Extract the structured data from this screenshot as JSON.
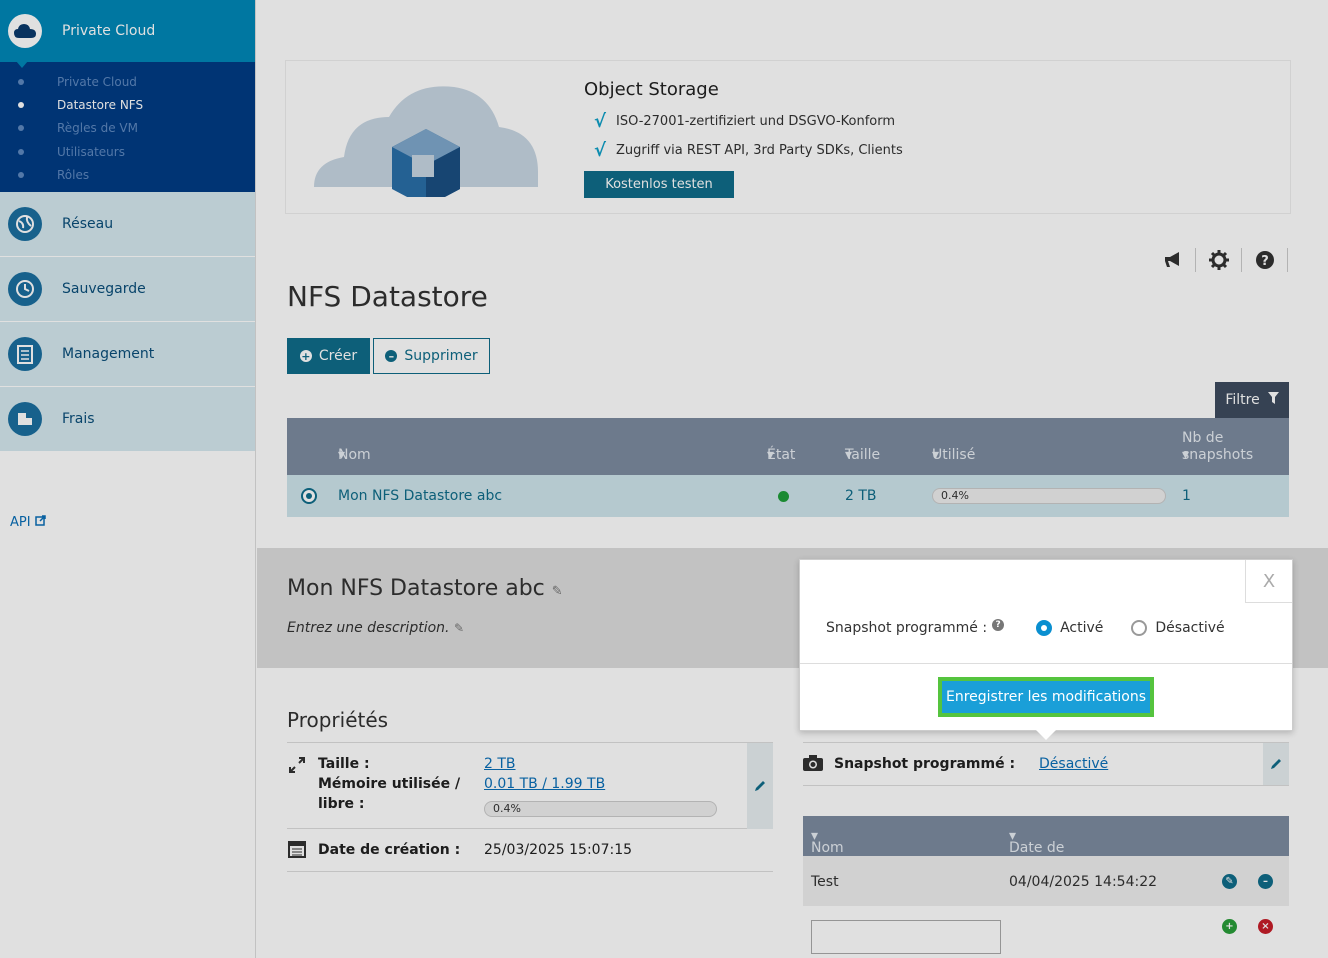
{
  "sidebar": {
    "top_label": "Private Cloud",
    "sub_items": [
      {
        "label": "Private Cloud"
      },
      {
        "label": "Datastore NFS"
      },
      {
        "label": "Règles de VM"
      },
      {
        "label": "Utilisateurs"
      },
      {
        "label": "Rôles"
      }
    ],
    "nav_items": [
      {
        "label": "Réseau",
        "icon": "globe-icon"
      },
      {
        "label": "Sauvegarde",
        "icon": "history-icon"
      },
      {
        "label": "Management",
        "icon": "clipboard-icon"
      },
      {
        "label": "Frais",
        "icon": "coins-icon"
      }
    ],
    "api_label": "API"
  },
  "banner": {
    "title": "Object Storage",
    "line1": "ISO-27001-zertifiziert und DSGVO-Konform",
    "line2": "Zugriff via REST API, 3rd Party SDKs, Clients",
    "button": "Kostenlos testen"
  },
  "page": {
    "title": "NFS Datastore",
    "create_label": "Créer",
    "delete_label": "Supprimer",
    "filter_label": "Filtre"
  },
  "table": {
    "headers": {
      "name": "Nom",
      "state": "État",
      "size": "Taille",
      "used": "Utilisé",
      "snapshots_1": "Nb de",
      "snapshots_2": "snapshots"
    },
    "row": {
      "name": "Mon NFS Datastore abc",
      "size": "2 TB",
      "used": "0.4%",
      "used_fraction": 0.004,
      "snapshots": "1"
    }
  },
  "detail": {
    "title": "Mon NFS Datastore abc",
    "description": "Entrez une description."
  },
  "properties": {
    "title": "Propriétés",
    "size_label": "Taille :",
    "size_value": "2 TB",
    "mem_label_1": "Mémoire utilisée /",
    "mem_label_2": "libre :",
    "mem_value": "0.01 TB / 1.99 TB",
    "mem_percent": "0.4%",
    "created_label": "Date de création :",
    "created_value": "25/03/2025 15:07:15"
  },
  "snapshot": {
    "label": "Snapshot programmé :",
    "value": "Désactivé",
    "table_headers": {
      "name": "Nom",
      "date": "Date de création"
    },
    "rows": [
      {
        "name": "Test",
        "date": "04/04/2025 14:54:22"
      }
    ]
  },
  "popover": {
    "close": "X",
    "label": "Snapshot programmé :",
    "option_on": "Activé",
    "option_off": "Désactivé",
    "selected": "Activé",
    "save": "Enregistrer les modifications"
  },
  "colors": {
    "primary": "#0f6d8a",
    "sidebar_dark": "#003c84",
    "sidebar_top": "#0088b8",
    "save_button": "#1a9fd8",
    "highlight_border": "#55c43e"
  }
}
